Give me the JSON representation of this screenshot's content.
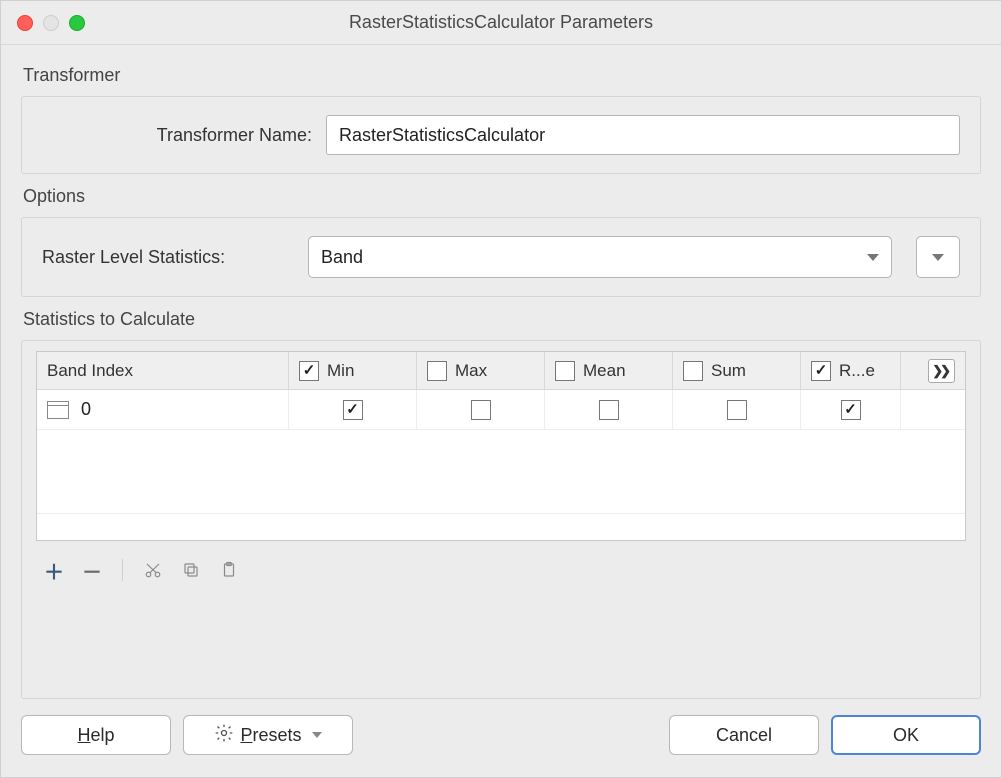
{
  "window": {
    "title": "RasterStatisticsCalculator Parameters"
  },
  "sections": {
    "transformer": "Transformer",
    "options": "Options",
    "statistics": "Statistics to Calculate"
  },
  "transformer": {
    "name_label": "Transformer Name:",
    "name_value": "RasterStatisticsCalculator"
  },
  "options": {
    "level_label": "Raster Level Statistics:",
    "level_value": "Band"
  },
  "table": {
    "headers": {
      "band_index": "Band Index",
      "min": "Min",
      "max": "Max",
      "mean": "Mean",
      "sum": "Sum",
      "re": "R...e"
    },
    "header_checks": {
      "min": true,
      "max": false,
      "mean": false,
      "sum": false,
      "re": true
    },
    "rows": [
      {
        "band_index": "0",
        "min": true,
        "max": false,
        "mean": false,
        "sum": false,
        "re": true
      }
    ],
    "expand_glyph": "❯❯"
  },
  "toolbar": {
    "add": "＋",
    "remove": "－",
    "cut": "✂",
    "copy": "⧉",
    "paste": "📋"
  },
  "buttons": {
    "help": "Help",
    "presets": "Presets",
    "cancel": "Cancel",
    "ok": "OK"
  },
  "icons": {
    "gear": "⚙"
  }
}
